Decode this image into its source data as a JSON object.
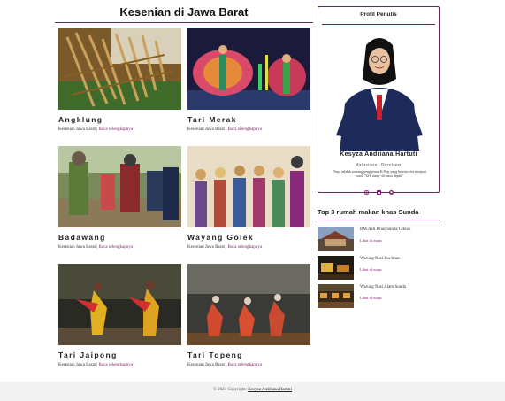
{
  "main": {
    "title": "Kesenian di Jawa Barat",
    "cards": [
      {
        "title": "Angklung",
        "category": "Kesenian Jawa Barat",
        "separator": "|",
        "link": "Baca selengkapnya"
      },
      {
        "title": "Tari Merak",
        "category": "Kesenian Jawa Barat",
        "separator": "|",
        "link": "Baca selengkapnya"
      },
      {
        "title": "Badawang",
        "category": "Kesenian Jawa Barat",
        "separator": "|",
        "link": "Baca selengkapnya"
      },
      {
        "title": "Wayang Golek",
        "category": "Kesenian Jawa Barat",
        "separator": "|",
        "link": "Baca selengkapnya"
      },
      {
        "title": "Tari Jaipong",
        "category": "Kesenian Jawa Barat",
        "separator": "|",
        "link": "Baca selengkapnya"
      },
      {
        "title": "Tari Topeng",
        "category": "Kesenian Jawa Barat",
        "separator": "|",
        "link": "Baca selengkapnya"
      }
    ]
  },
  "profile": {
    "title": "Profil Penulis",
    "name": "Kesyza Andriana Hartuti",
    "role": "Mahasiswa | Developer",
    "quote": "\"Saya adalah seorang penggemar K-Pop yang bercita-cita menjadi sosok 'Ya'k aunty' di masa depan\"",
    "socials": [
      "instagram-icon",
      "linkedin-icon",
      "github-icon"
    ]
  },
  "restaurants": {
    "title": "Top 3 rumah makan khas Sunda",
    "items": [
      {
        "name": "RM.Asli Khas Sunda Cibiuk",
        "link": "Lihat di maps"
      },
      {
        "name": "Warung Nasi Ibu Imas",
        "link": "Lihat di maps"
      },
      {
        "name": "Warung Nasi Alam Sunda",
        "link": "Lihat di maps"
      }
    ]
  },
  "footer": {
    "text": "© 2023 Copyright:",
    "author": "Kesyza Andriana Hartuti"
  },
  "colors": {
    "accent": "#6d1f5e",
    "link": "#7a1f6a",
    "footer_bg": "#f3f3f3"
  }
}
